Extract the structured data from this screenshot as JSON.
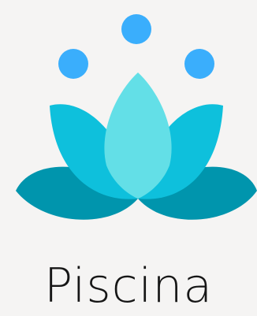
{
  "app_name": "Piscina",
  "logo": {
    "icon": "lotus-icon",
    "colors": {
      "dots": "#3aaefc",
      "outer_petals": "#0095ad",
      "middle_petals": "#0ec0dc",
      "center_petal": "#63dfe7"
    }
  }
}
